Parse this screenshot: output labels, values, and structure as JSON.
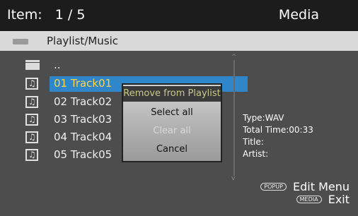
{
  "header": {
    "item_text": "Item:   1 / 5",
    "mode": "Media"
  },
  "path": {
    "text": "Playlist/Music"
  },
  "list": {
    "parent": "..",
    "tracks": [
      "01 Track01",
      "02 Track02",
      "03 Track03",
      "04 Track04",
      "05 Track05"
    ],
    "selected_index": 0
  },
  "popup": {
    "options": [
      "Remove from Playlist",
      "Select all",
      "Clear all",
      "Cancel"
    ],
    "highlighted": "Remove from Playlist",
    "disabled": [
      "Clear all"
    ]
  },
  "details": {
    "type": "Type:WAV",
    "total_time": "Total Time:00:33",
    "title": "Title:",
    "artist": "Artist:"
  },
  "hints": [
    {
      "key": "POPUP",
      "label": "Edit Menu"
    },
    {
      "key": "MEDIA",
      "label": "Exit"
    }
  ],
  "colors": {
    "selection": "#2f86c8",
    "selected_text": "#ffd24a",
    "header_bg": "#1c1c1c",
    "path_bg": "#d9d9d9"
  }
}
